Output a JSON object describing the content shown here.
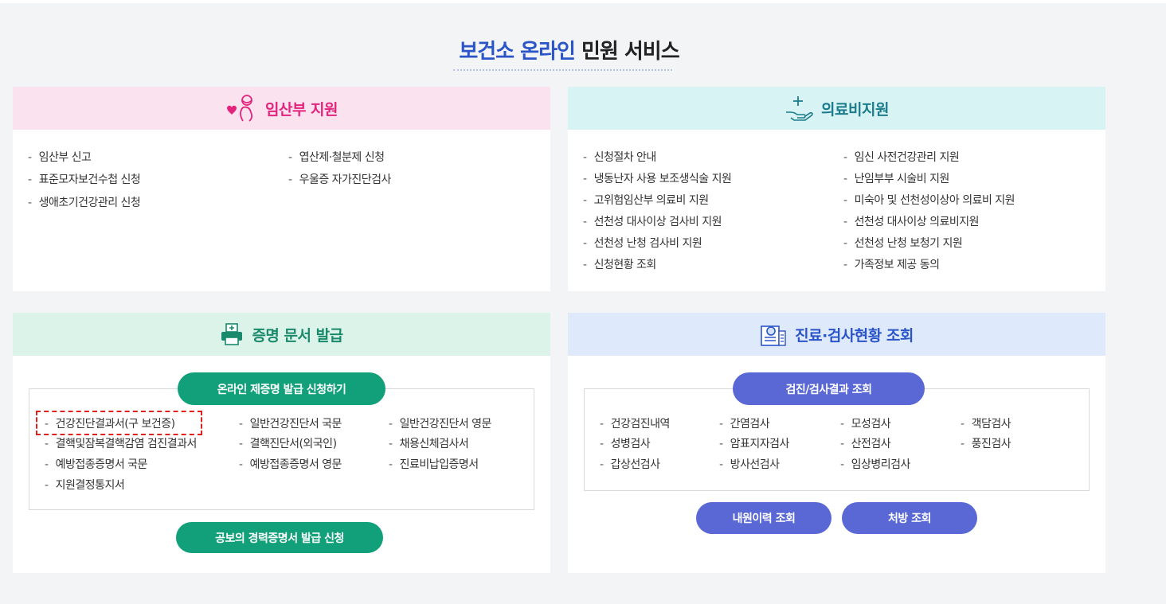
{
  "page": {
    "title_highlight": "보건소 온라인",
    "title_rest": "민원 서비스"
  },
  "pregnancy": {
    "title": "임산부 지원",
    "icon": "pregnant-woman-heart-icon",
    "items": [
      "임산부 신고",
      "엽산제·철분제 신청",
      "표준모자보건수첩 신청",
      "우울증 자가진단검사",
      "생애초기건강관리 신청"
    ]
  },
  "medical_support": {
    "title": "의료비지원",
    "icon": "hand-plus-icon",
    "items": [
      "신청절차 안내",
      "임신 사전건강관리 지원",
      "냉동난자 사용 보조생식술 지원",
      "난임부부 시술비 지원",
      "고위험임산부 의료비 지원",
      "미숙아 및 선천성이상아 의료비 지원",
      "선천성 대사이상 검사비 지원",
      "선천성 대사이상 의료비지원",
      "선천성 난청 검사비 지원",
      "선천성 난청 보청기 지원",
      "신청현황 조회",
      "가족정보 제공 동의"
    ]
  },
  "certificates": {
    "title": "증명 문서 발급",
    "icon": "printer-icon",
    "apply_button": "온라인 제증명 발급 신청하기",
    "items": [
      "건강진단결과서(구 보건증)",
      "일반건강진단서 국문",
      "일반건강진단서 영문",
      "결핵및잠복결핵감염 검진결과서",
      "결핵진단서(외국인)",
      "채용신체검사서",
      "예방접종증명서 국문",
      "예방접종증명서 영문",
      "진료비납입증명서",
      "지원결정통지서"
    ],
    "career_button": "공보의 경력증명서 발급 신청"
  },
  "inquiry": {
    "title": "진료·검사현황 조회",
    "icon": "document-search-icon",
    "results_button": "검진/검사결과 조회",
    "items": [
      "건강검진내역",
      "간염검사",
      "모성검사",
      "객담검사",
      "성병검사",
      "암표지자검사",
      "산전검사",
      "풍진검사",
      "갑상선검사",
      "방사선검사",
      "임상병리검사"
    ],
    "visit_button": "내원이력 조회",
    "prescription_button": "처방 조회"
  },
  "colors": {
    "accent_blue": "#2b54c8",
    "pink": "#e2247d",
    "teal": "#1b7c8c",
    "green": "#12a07a",
    "violet": "#5968d4",
    "highlight_red": "#e0201c"
  }
}
